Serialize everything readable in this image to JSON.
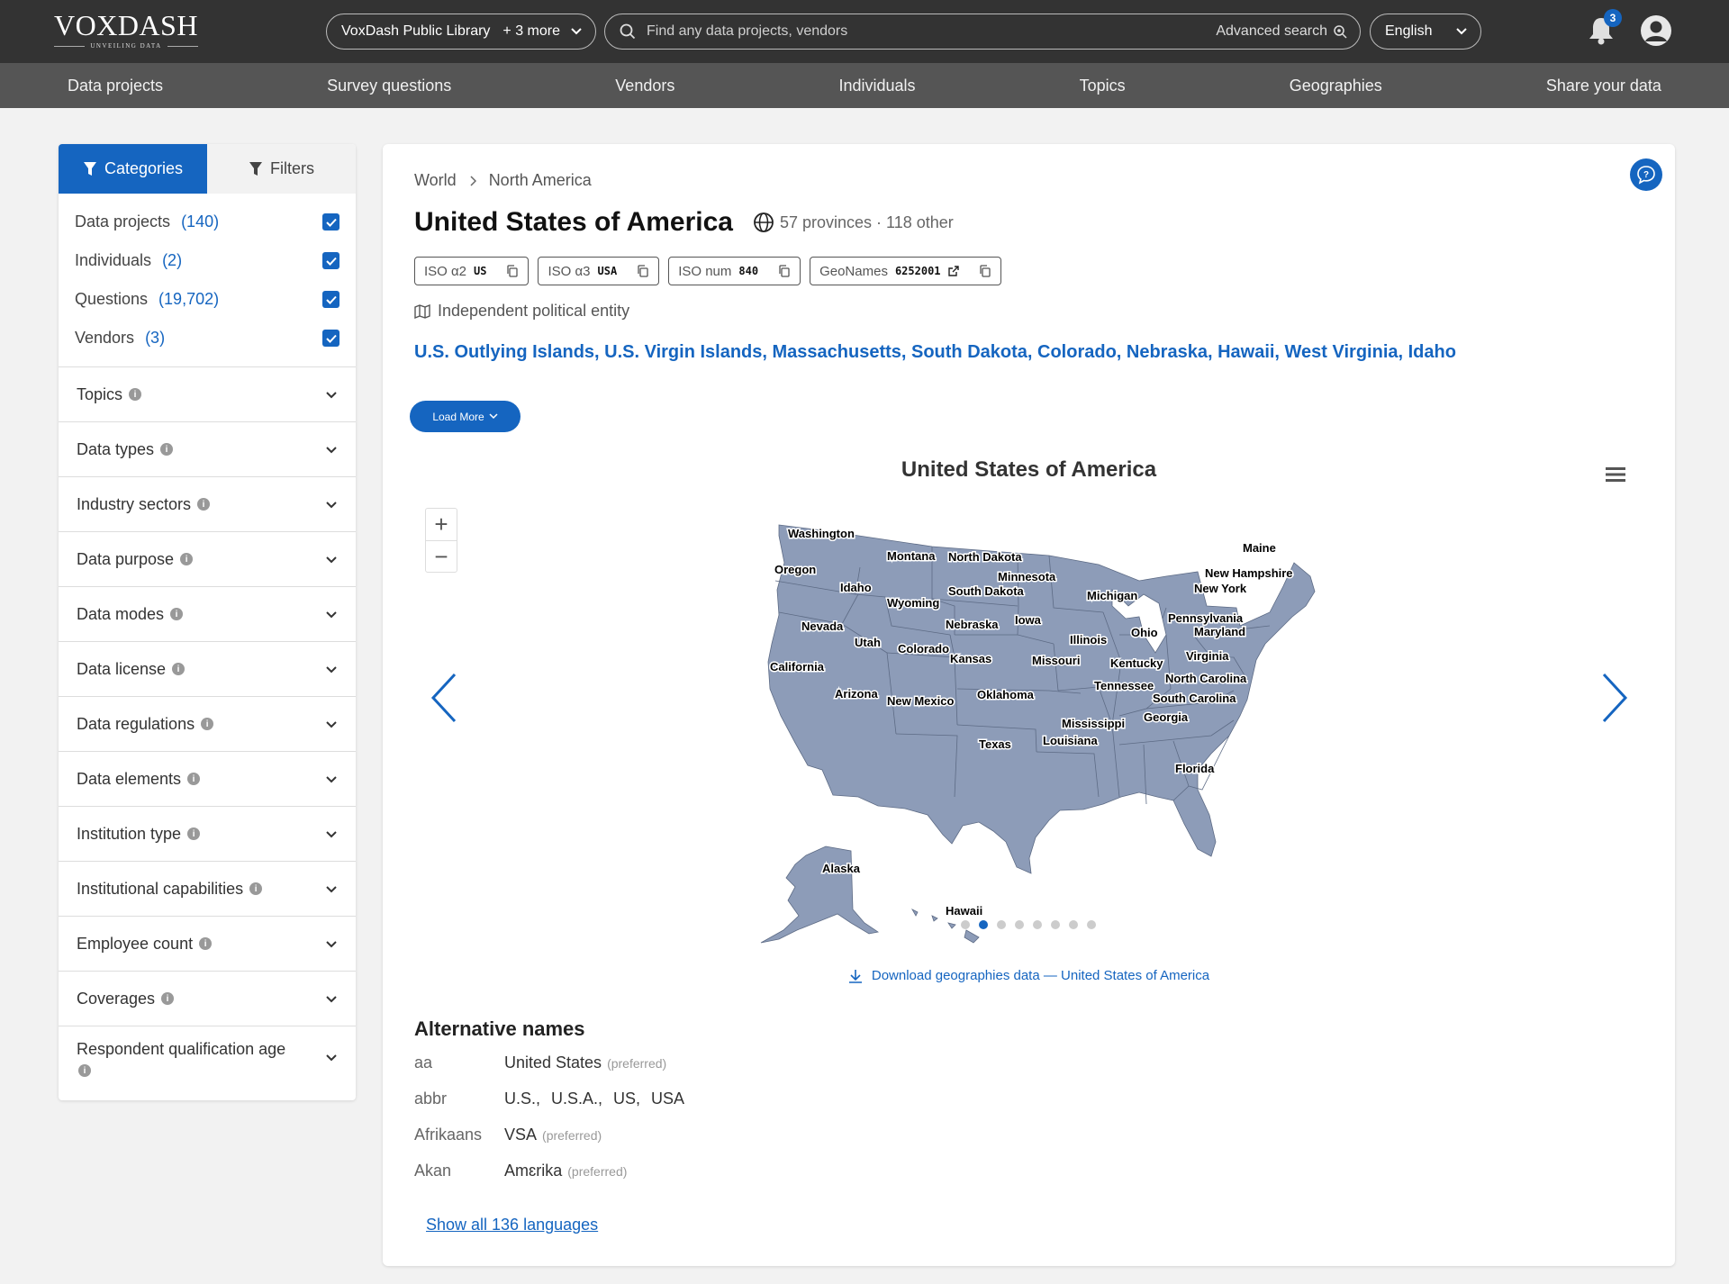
{
  "header": {
    "logo": "VOXDASH",
    "logo_tagline": "UNVEILING DATA",
    "library": "VoxDash Public Library",
    "library_more": "+ 3 more",
    "search_placeholder": "Find any data projects, vendors",
    "advanced_search": "Advanced search",
    "language": "English",
    "notification_count": "3"
  },
  "nav": [
    "Data projects",
    "Survey questions",
    "Vendors",
    "Individuals",
    "Topics",
    "Geographies",
    "Share your data"
  ],
  "sidebar": {
    "tab_categories": "Categories",
    "tab_filters": "Filters",
    "categories": [
      {
        "label": "Data projects",
        "count": "(140)",
        "checked": true
      },
      {
        "label": "Individuals",
        "count": "(2)",
        "checked": true
      },
      {
        "label": "Questions",
        "count": "(19,702)",
        "checked": true
      },
      {
        "label": "Vendors",
        "count": "(3)",
        "checked": true
      }
    ],
    "facets": [
      "Topics",
      "Data types",
      "Industry sectors",
      "Data purpose",
      "Data modes",
      "Data license",
      "Data regulations",
      "Data elements",
      "Institution type",
      "Institutional capabilities",
      "Employee count",
      "Coverages",
      "Respondent qualification age"
    ]
  },
  "main": {
    "breadcrumb": [
      "World",
      "North America"
    ],
    "title": "United States of America",
    "meta": "57 provinces · 118 other",
    "codes": [
      {
        "label": "ISO α2",
        "value": "US"
      },
      {
        "label": "ISO α3",
        "value": "USA"
      },
      {
        "label": "ISO num",
        "value": "840"
      },
      {
        "label": "GeoNames",
        "value": "6252001"
      }
    ],
    "entity_type": "Independent political entity",
    "subdivisions": "U.S. Outlying Islands, U.S. Virgin Islands, Massachusetts, South Dakota, Colorado, Nebraska, Hawaii, West Virginia, Idaho",
    "load_more": "Load More",
    "map_title": "United States of America",
    "map_states": [
      "Washington",
      "Oregon",
      "California",
      "Nevada",
      "Idaho",
      "Montana",
      "Wyoming",
      "Utah",
      "Arizona",
      "Colorado",
      "New Mexico",
      "North Dakota",
      "South Dakota",
      "Nebraska",
      "Kansas",
      "Oklahoma",
      "Texas",
      "Minnesota",
      "Iowa",
      "Missouri",
      "Illinois",
      "Michigan",
      "Ohio",
      "Kentucky",
      "Tennessee",
      "Mississippi",
      "Louisiana",
      "Georgia",
      "Florida",
      "South Carolina",
      "North Carolina",
      "Virginia",
      "Maryland",
      "Pennsylvania",
      "New York",
      "New Hampshire",
      "Maine",
      "Alaska",
      "Hawaii"
    ],
    "carousel_dots": 8,
    "carousel_active": 1,
    "download": "Download geographies data — United States of America",
    "alt_names_title": "Alternative names",
    "alt_names": [
      {
        "lang": "aa",
        "value": "United States",
        "note": "(preferred)"
      },
      {
        "lang": "abbr",
        "values": [
          "U.S.,",
          "U.S.A.,",
          "US,",
          "USA"
        ]
      },
      {
        "lang": "Afrikaans",
        "value": "VSA",
        "note": "(preferred)"
      },
      {
        "lang": "Akan",
        "value": "Amɛrika",
        "note": "(preferred)"
      }
    ],
    "show_all": "Show all 136 languages"
  },
  "colors": {
    "accent": "#1565c0",
    "topbar": "#333333",
    "nav": "#555555",
    "map_fill": "#8d9cb8"
  }
}
